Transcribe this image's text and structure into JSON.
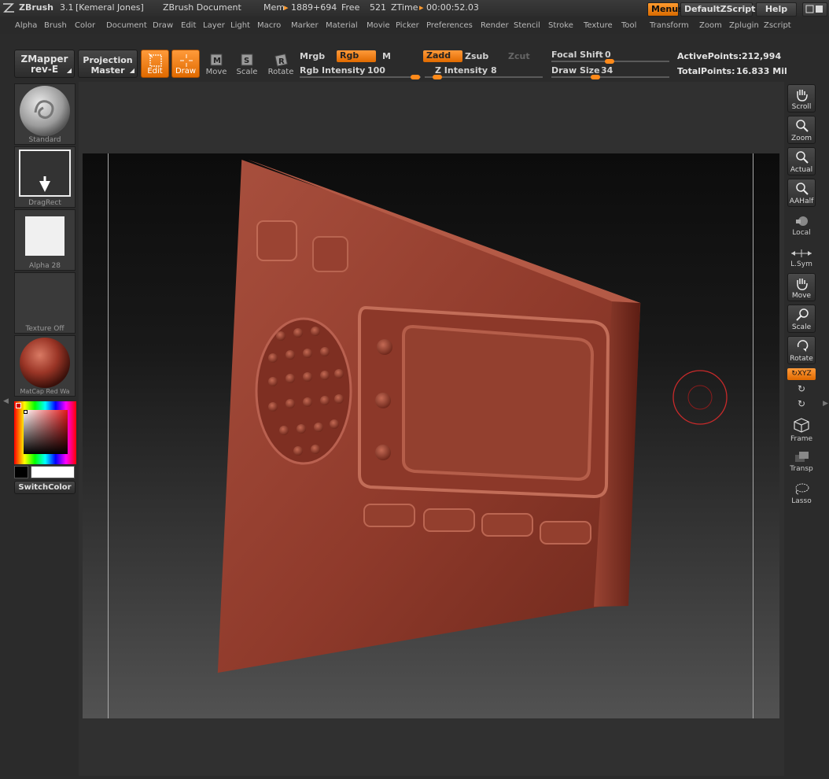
{
  "titlebar": {
    "app": "ZBrush",
    "version": "3.1",
    "user": "[Kemeral Jones]",
    "document": "ZBrush Document",
    "mem_label": "Mem",
    "mem_value": "1889+694",
    "free_label": "Free",
    "free_value": "521",
    "ztime_label": "ZTime",
    "ztime_value": "00:00:52.03",
    "menus_btn": "Menus",
    "script_btn": "DefaultZScript",
    "help_btn": "Help"
  },
  "menu": [
    "Alpha",
    "Brush",
    "Color",
    "Document",
    "Draw",
    "Edit",
    "Layer",
    "Light",
    "Macro",
    "Marker",
    "Material",
    "Movie",
    "Picker",
    "Preferences",
    "Render",
    "Stencil",
    "Stroke",
    "Texture",
    "Tool",
    "Transform",
    "Zoom",
    "Zplugin",
    "Zscript"
  ],
  "shelf": {
    "zmapper_line1": "ZMapper",
    "zmapper_line2": "rev-E",
    "projection_line1": "Projection",
    "projection_line2": "Master",
    "edit": "Edit",
    "draw": "Draw",
    "move": "Move",
    "scale": "Scale",
    "rotate": "Rotate",
    "mrgb": "Mrgb",
    "rgb": "Rgb",
    "m": "M",
    "rgb_intensity_label": "Rgb Intensity",
    "rgb_intensity_value": "100",
    "zadd": "Zadd",
    "zsub": "Zsub",
    "zcut": "Zcut",
    "z_intensity_label": "Z Intensity",
    "z_intensity_value": "8",
    "focal_shift_label": "Focal Shift",
    "focal_shift_value": "0",
    "draw_size_label": "Draw Size",
    "draw_size_value": "34",
    "active_points_label": "ActivePoints:",
    "active_points_value": "212,994",
    "total_points_label": "TotalPoints:",
    "total_points_value": "16.833 Mil"
  },
  "left_tray": {
    "brush": "Standard",
    "stroke": "DragRect",
    "alpha": "Alpha 28",
    "texture": "Texture Off",
    "material": "MatCap Red Wa",
    "switch_color": "SwitchColor"
  },
  "right_tray": {
    "scroll": "Scroll",
    "zoom": "Zoom",
    "actual": "Actual",
    "aahalf": "AAHalf",
    "local": "Local",
    "lsym": "L.Sym",
    "move": "Move",
    "scale": "Scale",
    "rotate": "Rotate",
    "xyz": "XYZ",
    "frame": "Frame",
    "transp": "Transp",
    "lasso": "Lasso"
  },
  "colors": {
    "accent": "#e8770e",
    "model": "#8a3a2c",
    "background": "#2b2b2b"
  }
}
